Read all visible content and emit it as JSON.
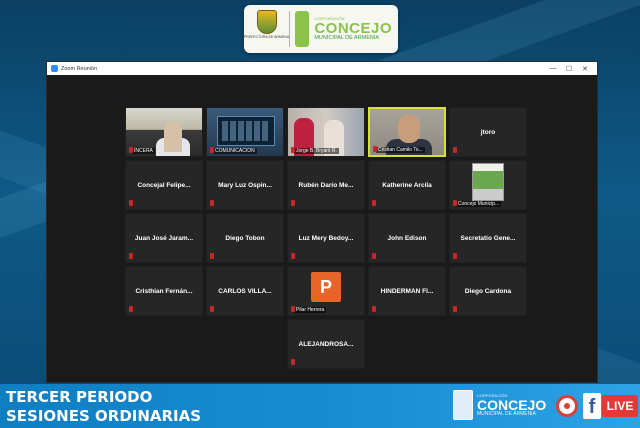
{
  "logo": {
    "crest_caption": "PREFECTURA DE ARMENIA",
    "small_text": "CORPORACIÓN",
    "name": "CONCEJO",
    "subtitle": "MUNICIPAL DE ARMENIA"
  },
  "zoom": {
    "window_title": "Zoom Reunión",
    "buttons": {
      "minimize": "—",
      "maximize": "☐",
      "close": "✕"
    }
  },
  "tiles": [
    {
      "kind": "video",
      "video": "v1",
      "caption": "INCERA",
      "active": false
    },
    {
      "kind": "video",
      "video": "v2",
      "caption": "COMUNICACION",
      "active": false
    },
    {
      "kind": "video",
      "video": "v3",
      "caption": "Jorge B. Bryant R.",
      "active": false
    },
    {
      "kind": "video",
      "video": "v4",
      "caption": "Cristian Camilo To...",
      "active": true
    },
    {
      "kind": "name",
      "name": "jtoro"
    },
    {
      "kind": "name",
      "name": "Concejal Felipe..."
    },
    {
      "kind": "name",
      "name": "Mary Luz Ospin..."
    },
    {
      "kind": "name",
      "name": "Rubén Darío Me..."
    },
    {
      "kind": "name",
      "name": "Katherine Arcila"
    },
    {
      "kind": "poster",
      "caption": "Concejo Municip..."
    },
    {
      "kind": "name",
      "name": "Juan José Jaram..."
    },
    {
      "kind": "name",
      "name": "Diego Tobon"
    },
    {
      "kind": "name",
      "name": "Luz Mery Bedoy..."
    },
    {
      "kind": "name",
      "name": "John Edison"
    },
    {
      "kind": "name",
      "name": "Secretatio Gene..."
    },
    {
      "kind": "name",
      "name": "Cristhian Fernán..."
    },
    {
      "kind": "name",
      "name": "CARLOS VILLA..."
    },
    {
      "kind": "avatar",
      "letter": "P",
      "caption": "Pilar Herrera"
    },
    {
      "kind": "name",
      "name": "HINDERMAN FI..."
    },
    {
      "kind": "name",
      "name": "Diego Cardona"
    },
    {
      "kind": "empty"
    },
    {
      "kind": "empty"
    },
    {
      "kind": "name",
      "name": "ALEJANDROSA..."
    }
  ],
  "banner": {
    "line1": "TERCER PERIODO",
    "line2": "SESIONES ORDINARIAS",
    "logo_small": "CORPORACIÓN",
    "logo_name": "CONCEJO",
    "logo_sub": "MUNICIPAL DE ARMENIA",
    "fb_letter": "f",
    "live": "LIVE"
  }
}
